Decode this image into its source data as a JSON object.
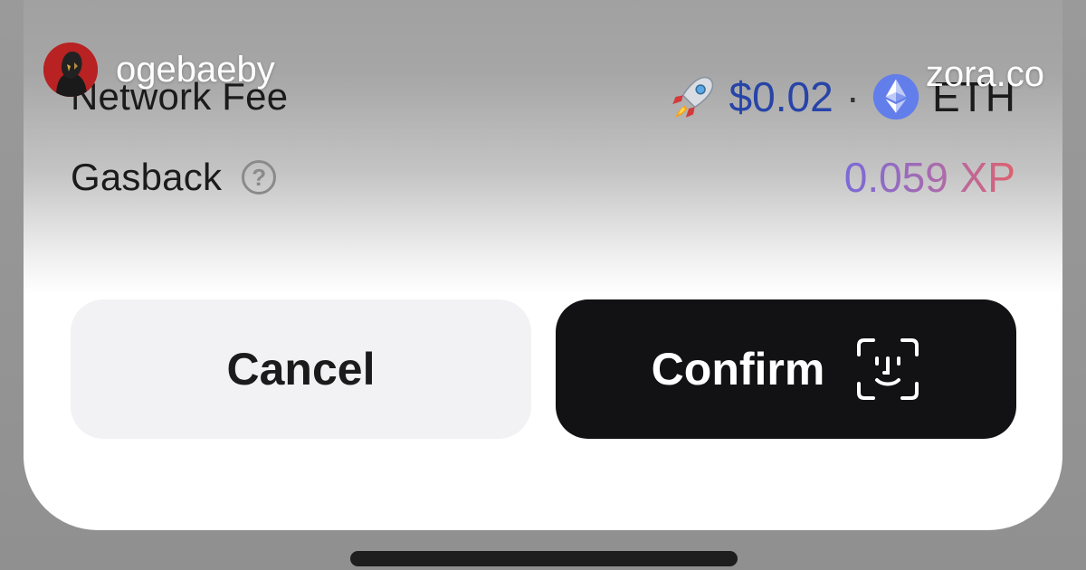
{
  "overlay": {
    "username": "ogebaeby",
    "domain": "zora.co",
    "avatar_icon": "profile-avatar"
  },
  "sheet": {
    "network_fee": {
      "label": "Network Fee",
      "icon": "rocket-icon",
      "usd": "$0.02",
      "separator": "·",
      "token_icon": "ethereum-icon",
      "token": "ETH"
    },
    "gasback": {
      "label": "Gasback",
      "help_icon": "question-circle-icon",
      "help_glyph": "?",
      "value": "0.059 XP"
    },
    "buttons": {
      "cancel_label": "Cancel",
      "confirm_label": "Confirm",
      "confirm_icon": "face-id-icon"
    }
  },
  "colors": {
    "usd_blue": "#2744a8",
    "confirm_bg": "#121114",
    "cancel_bg": "#f2f2f4",
    "xp_gradient_start": "#7a6ad8",
    "xp_gradient_end": "#e0606e"
  }
}
